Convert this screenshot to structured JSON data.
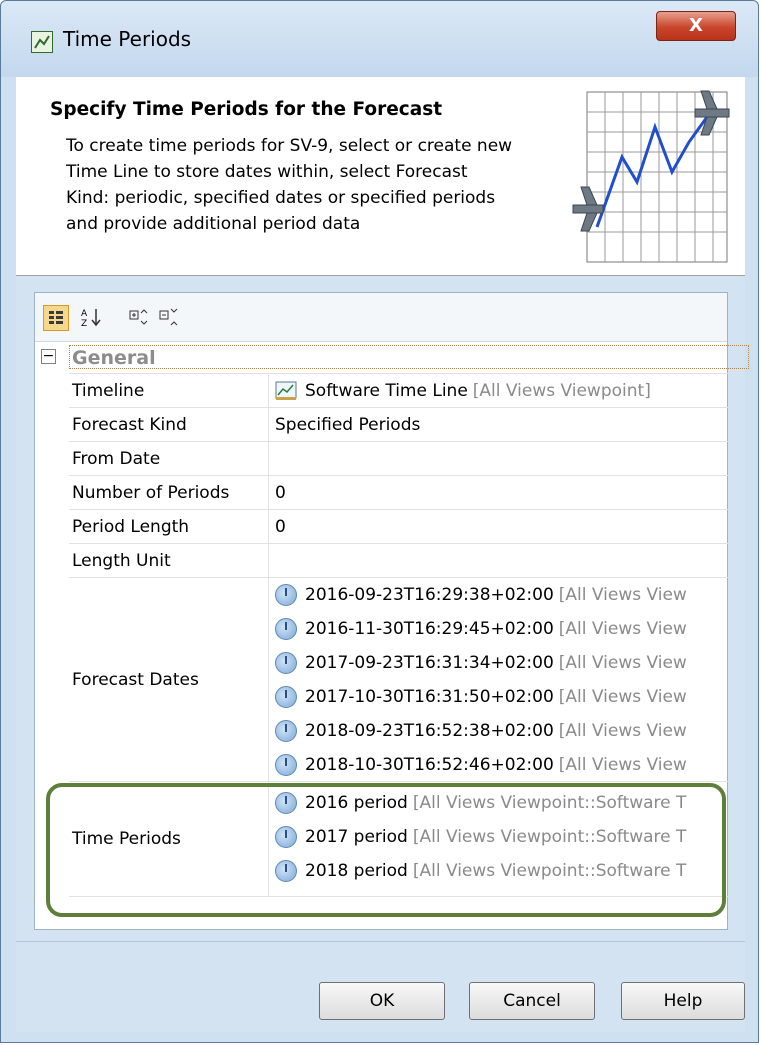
{
  "window": {
    "title": "Time Periods",
    "close_label": "X"
  },
  "header": {
    "title": "Specify Time Periods for the Forecast",
    "description": "To create time periods for SV-9, select or create new Time Line to store dates within, select Forecast Kind: periodic, specified dates or specified periods and provide additional period data"
  },
  "toolbar": {
    "buttons": [
      "categorized-view-icon",
      "sort-alphabetically-icon",
      "expand-all-icon",
      "collapse-all-icon"
    ]
  },
  "properties": {
    "group": {
      "label": "General",
      "toggle": "−"
    },
    "timeline": {
      "name": "Timeline",
      "value": "Software Time Line",
      "scope": "[All Views Viewpoint]"
    },
    "forecast_kind": {
      "name": "Forecast Kind",
      "value": "Specified Periods"
    },
    "from_date": {
      "name": "From Date",
      "value": ""
    },
    "number_of_periods": {
      "name": "Number of Periods",
      "value": "0"
    },
    "period_length": {
      "name": "Period Length",
      "value": "0"
    },
    "length_unit": {
      "name": "Length Unit",
      "value": ""
    },
    "forecast_dates": {
      "name": "Forecast Dates",
      "items": [
        {
          "value": "2016-09-23T16:29:38+02:00",
          "scope": "[All Views View"
        },
        {
          "value": "2016-11-30T16:29:45+02:00",
          "scope": "[All Views View"
        },
        {
          "value": "2017-09-23T16:31:34+02:00",
          "scope": "[All Views View"
        },
        {
          "value": "2017-10-30T16:31:50+02:00",
          "scope": "[All Views View"
        },
        {
          "value": "2018-09-23T16:52:38+02:00",
          "scope": "[All Views View"
        },
        {
          "value": "2018-10-30T16:52:46+02:00",
          "scope": "[All Views View"
        }
      ]
    },
    "time_periods": {
      "name": "Time Periods",
      "items": [
        {
          "value": "2016 period",
          "scope": "[All Views Viewpoint::Software T"
        },
        {
          "value": "2017 period",
          "scope": "[All Views Viewpoint::Software T"
        },
        {
          "value": "2018 period",
          "scope": "[All Views Viewpoint::Software T"
        }
      ]
    }
  },
  "footer": {
    "ok_label": "OK",
    "cancel_label": "Cancel",
    "help_label": "Help"
  },
  "colors": {
    "highlight": "#5d7f3b",
    "accent": "#f6d88c"
  }
}
